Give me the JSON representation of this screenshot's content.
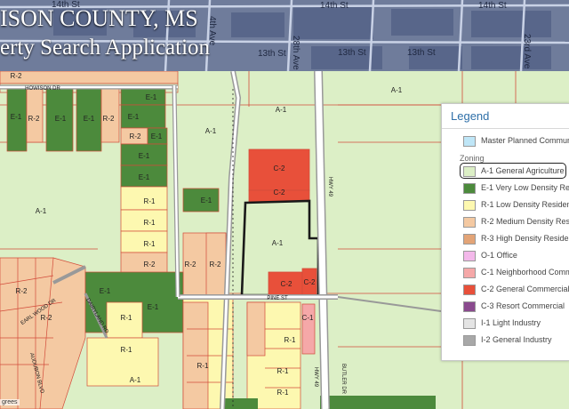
{
  "banner": {
    "title_line1": "ISON COUNTY, MS",
    "title_line2": "erty Search Application",
    "streets": [
      "14th St",
      "14th St",
      "14th St",
      "13th St",
      "13th St",
      "13th St",
      "4th Ave",
      "28th Ave",
      "23rd Ave"
    ]
  },
  "map_labels": {
    "zones": [
      "A-1",
      "A-1",
      "A-1",
      "A-1",
      "A-1",
      "A-1",
      "E-1",
      "E-1",
      "E-1",
      "E-1",
      "E-1",
      "E-1",
      "E-1",
      "E-1",
      "E-1",
      "E-1",
      "E-1",
      "R-1",
      "R-1",
      "R-1",
      "R-1",
      "R-1",
      "R-1",
      "R-1",
      "R-1",
      "R-1",
      "R-2",
      "R-2",
      "R-2",
      "R-2",
      "R-2",
      "R-2",
      "R-2",
      "R-2",
      "R-2",
      "C-1",
      "C-2",
      "C-2",
      "C-2",
      "C-2"
    ],
    "roads": [
      "HOWISON DR",
      "PINE ST",
      "HWY 49",
      "HWY 49",
      "BUTLER DR",
      "DAIRYLAND RD",
      "AUDUBON BLVD",
      "EARL WOOD DR"
    ]
  },
  "legend": {
    "title": "Legend",
    "master_planned": "Master Planned Communi",
    "zoning_heading": "Zoning",
    "items": [
      {
        "label": "A-1 General Agriculture",
        "color": "#dcefc6"
      },
      {
        "label": "E-1 Very Low Density Resi",
        "color": "#4c8a3c"
      },
      {
        "label": "R-1 Low Density Residen",
        "color": "#fdf8b0"
      },
      {
        "label": "R-2 Medium Density Resi",
        "color": "#f4c9a2"
      },
      {
        "label": "R-3 High Density Residen",
        "color": "#e3a477"
      },
      {
        "label": "O-1 Office",
        "color": "#f3b8ea"
      },
      {
        "label": "C-1 Neighborhood Comm",
        "color": "#f5a8a8"
      },
      {
        "label": "C-2 General Commercial",
        "color": "#e8503a"
      },
      {
        "label": "C-3 Resort Commercial",
        "color": "#8a4a8e"
      },
      {
        "label": "I-1 Light Industry",
        "color": "#e4e4e4"
      },
      {
        "label": "I-2 General Industry",
        "color": "#a8a8a8"
      }
    ],
    "master_color": "#bfe6f7",
    "selected_index": 0
  },
  "scale_text": "grees"
}
